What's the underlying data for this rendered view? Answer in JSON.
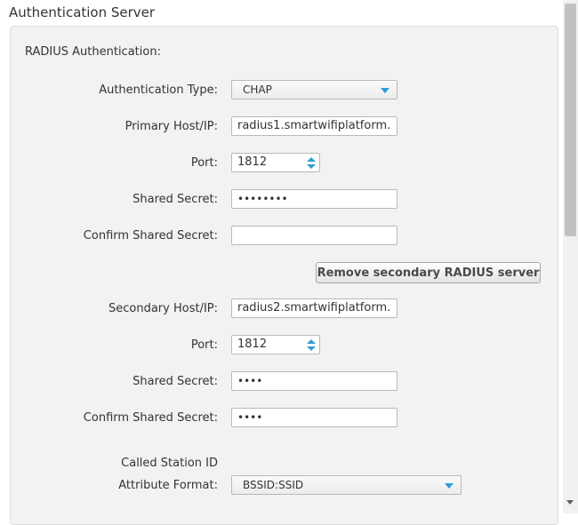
{
  "section_title": "Authentication Server",
  "panel_title": "RADIUS Authentication:",
  "auth_type": {
    "label": "Authentication Type:",
    "value": "CHAP"
  },
  "primary": {
    "host_label": "Primary Host/IP:",
    "host_value": "radius1.smartwifiplatform.",
    "port_label": "Port:",
    "port_value": "1812",
    "secret_label": "Shared Secret:",
    "secret_value": "••••••••",
    "confirm_label": "Confirm Shared Secret:",
    "confirm_value": ""
  },
  "remove_button": "Remove secondary RADIUS server",
  "secondary": {
    "host_label": "Secondary Host/IP:",
    "host_value": "radius2.smartwifiplatform.",
    "port_label": "Port:",
    "port_value": "1812",
    "secret_label": "Shared Secret:",
    "secret_value": "••••",
    "confirm_label": "Confirm Shared Secret:",
    "confirm_value": "••••"
  },
  "called_station": {
    "label_line1": "Called Station ID",
    "label_line2": "Attribute Format:",
    "value": "BSSID:SSID"
  },
  "colors": {
    "accent": "#2a9fd6",
    "panel_bg": "#f2f2f2",
    "text": "#333333"
  }
}
